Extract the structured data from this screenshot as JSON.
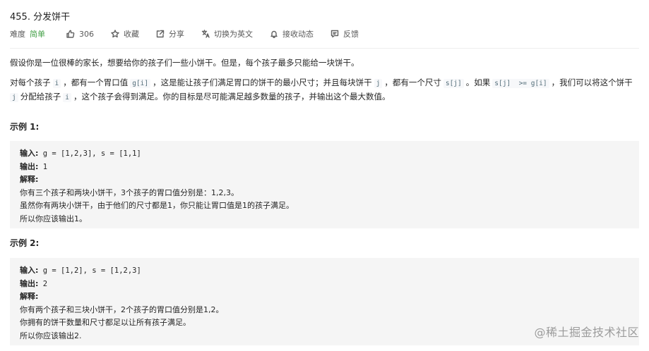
{
  "title": "455. 分发饼干",
  "meta": {
    "difficulty_label": "难度",
    "difficulty": "简单",
    "likes": "306",
    "favorite": "收藏",
    "share": "分享",
    "switch_lang": "切换为英文",
    "notify": "接收动态",
    "feedback": "反馈"
  },
  "description": {
    "p1": "假设你是一位很棒的家长，想要给你的孩子们一些小饼干。但是，每个孩子最多只能给一块饼干。",
    "p2_a": "对每个孩子",
    "code_i": "i",
    "p2_b": "，都有一个胃口值",
    "code_gi": "g[i]",
    "p2_c": "，这是能让孩子们满足胃口的饼干的最小尺寸；并且每块饼干",
    "code_j": "j",
    "p2_d": "，都有一个尺寸",
    "code_sj": "s[j]",
    "p2_e": "。如果",
    "code_cond": "s[j]  >= g[i]",
    "p2_f": "，我们可以将这个饼干",
    "code_j2": "j",
    "p2_g": "分配给孩子",
    "code_i2": "i",
    "p2_h": "，这个孩子会得到满足。你的目标是尽可能满足越多数量的孩子，并输出这个最大数值。"
  },
  "examples": [
    {
      "label": "示例 1:",
      "input_label": "输入:",
      "input": " g = [1,2,3], s = [1,1]",
      "output_label": "输出:",
      "output": " 1",
      "explain_label": "解释:",
      "lines": [
        "你有三个孩子和两块小饼干，3个孩子的胃口值分别是：1,2,3。",
        "虽然你有两块小饼干，由于他们的尺寸都是1，你只能让胃口值是1的孩子满足。",
        "所以你应该输出1。"
      ]
    },
    {
      "label": "示例 2:",
      "input_label": "输入:",
      "input": " g = [1,2], s = [1,2,3]",
      "output_label": "输出:",
      "output": " 2",
      "explain_label": "解释:",
      "lines": [
        "你有两个孩子和三块小饼干，2个孩子的胃口值分别是1,2。",
        "你拥有的饼干数量和尺寸都足以让所有孩子满足。",
        "所以你应该输出2."
      ]
    }
  ],
  "watermark": "@稀土掘金技术社区",
  "colors": {
    "easy": "#43a047",
    "code_bg": "#f7f8fa",
    "example_bg": "#f5f5f5"
  }
}
